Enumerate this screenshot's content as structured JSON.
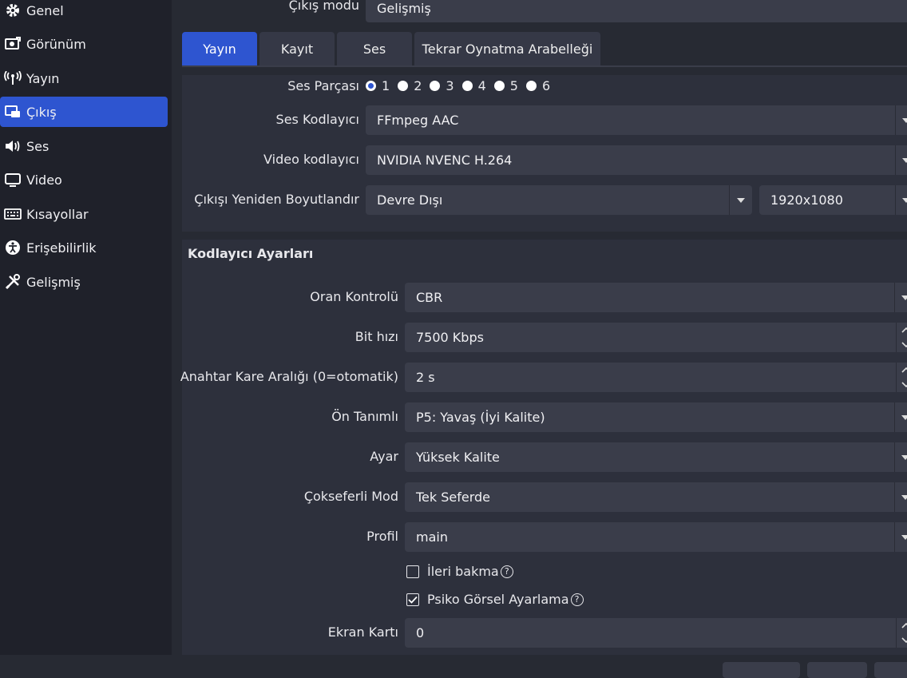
{
  "sidebar": {
    "items": [
      {
        "label": "Genel",
        "icon": "gear-icon"
      },
      {
        "label": "Görünüm",
        "icon": "appearance-icon"
      },
      {
        "label": "Yayın",
        "icon": "broadcast-icon"
      },
      {
        "label": "Çıkış",
        "icon": "output-icon",
        "active": true
      },
      {
        "label": "Ses",
        "icon": "speaker-icon"
      },
      {
        "label": "Video",
        "icon": "monitor-icon"
      },
      {
        "label": "Kısayollar",
        "icon": "keyboard-icon"
      },
      {
        "label": "Erişebilirlik",
        "icon": "accessibility-icon"
      },
      {
        "label": "Gelişmiş",
        "icon": "tools-icon"
      }
    ]
  },
  "output_mode": {
    "label": "Çıkış modu",
    "value": "Gelişmiş"
  },
  "tabs": [
    "Yayın",
    "Kayıt",
    "Ses",
    "Tekrar Oynatma Arabelleği"
  ],
  "audio_track": {
    "label": "Ses Parçası",
    "options": [
      "1",
      "2",
      "3",
      "4",
      "5",
      "6"
    ],
    "selected": "1"
  },
  "audio_encoder": {
    "label": "Ses Kodlayıcı",
    "value": "FFmpeg AAC"
  },
  "video_encoder": {
    "label": "Video kodlayıcı",
    "value": "NVIDIA NVENC H.264"
  },
  "rescale": {
    "label": "Çıkışı Yeniden Boyutlandır",
    "value": "Devre Dışı",
    "resolution": "1920x1080"
  },
  "encoder_settings": {
    "heading": "Kodlayıcı Ayarları",
    "rate_control": {
      "label": "Oran Kontrolü",
      "value": "CBR"
    },
    "bitrate": {
      "label": "Bit hızı",
      "value": "7500 Kbps"
    },
    "keyframe": {
      "label": "Anahtar Kare Aralığı (0=otomatik)",
      "value": "2 s"
    },
    "preset": {
      "label": "Ön Tanımlı",
      "value": "P5: Yavaş (İyi Kalite)"
    },
    "tuning": {
      "label": "Ayar",
      "value": "Yüksek Kalite"
    },
    "multipass": {
      "label": "Çokseferli Mod",
      "value": "Tek Seferde"
    },
    "profile": {
      "label": "Profil",
      "value": "main"
    },
    "lookahead": {
      "label": "İleri bakma",
      "checked": false
    },
    "psycho_visual": {
      "label": "Psiko Görsel Ayarlama",
      "checked": true
    },
    "gpu": {
      "label": "Ekran Kartı",
      "value": "0"
    }
  },
  "colors": {
    "accent": "#2e55d0",
    "background": "#272a33",
    "field": "#3a3d4a"
  }
}
